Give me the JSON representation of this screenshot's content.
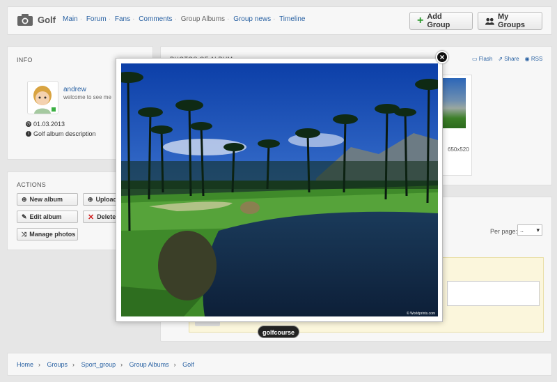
{
  "header": {
    "title": "Golf",
    "nav": [
      {
        "label": "Main",
        "active": false
      },
      {
        "label": "Forum",
        "active": false
      },
      {
        "label": "Fans",
        "active": false
      },
      {
        "label": "Comments",
        "active": false
      },
      {
        "label": "Group Albums",
        "active": true
      },
      {
        "label": "Group news",
        "active": false
      },
      {
        "label": "Timeline",
        "active": false
      }
    ],
    "add_group_label": "Add Group",
    "my_groups_label": "My Groups"
  },
  "info": {
    "title": "INFO",
    "user_name": "andrew",
    "user_status": "welcome to see me",
    "date": "01.03.2013",
    "description": "Golf album description"
  },
  "actions": {
    "title": "ACTIONS",
    "new_album": "New album",
    "upload": "Upload",
    "edit_album": "Edit album",
    "delete": "Delete",
    "manage_photos": "Manage photos"
  },
  "photos": {
    "title": "PHOTOS OF ALBUM",
    "links": [
      "Flash",
      "Share",
      "RSS"
    ],
    "thumb_size": "650x520"
  },
  "lower": {
    "per_page_label": "Per page:",
    "per_page_value": ".."
  },
  "breadcrumb": [
    "Home",
    "Groups",
    "Sport_group",
    "Group Albums",
    "Golf"
  ],
  "lightbox": {
    "caption": "golfcourse",
    "watermark": "© Worldprints.com",
    "close": "×"
  },
  "colors": {
    "link": "#2a62a3",
    "add_icon": "#2b9a2b",
    "delete_icon": "#d02020",
    "highlight_bg": "#fbf6dc"
  }
}
